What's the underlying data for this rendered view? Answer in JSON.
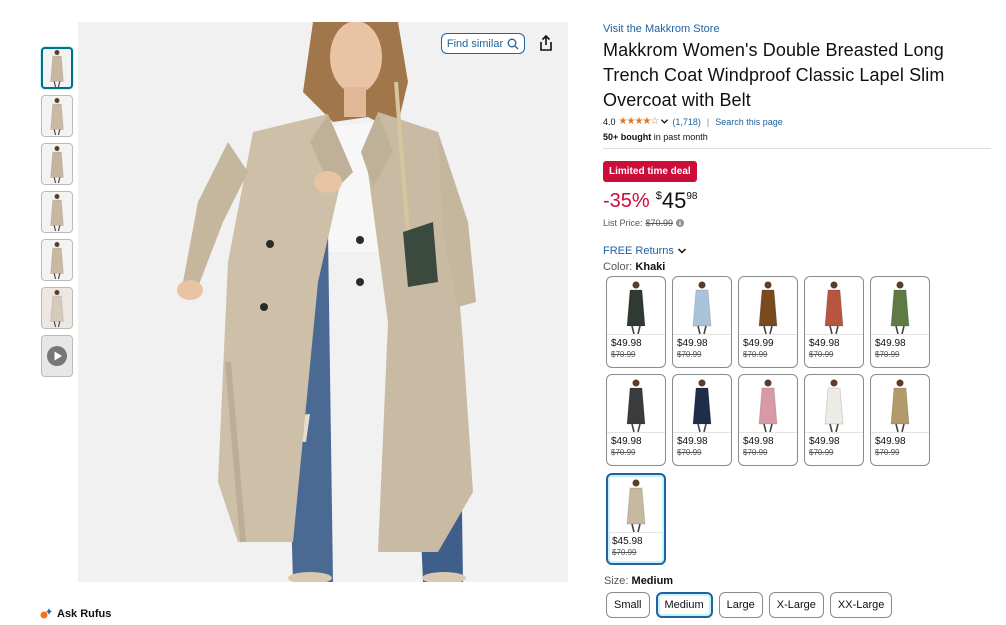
{
  "store": {
    "link": "Visit the Makkrom Store"
  },
  "product": {
    "title": "Makkrom Women's Double Breasted Long Trench Coat Windproof Classic Lapel Slim Overcoat with Belt",
    "rating": "4.0",
    "stars": "★★★★☆",
    "rating_count": "(1,718)",
    "search_page": "Search this page",
    "bought_bold": "50+ bought",
    "bought_rest": " in past month"
  },
  "deal": {
    "badge": "Limited time deal",
    "discount": "-35%",
    "price_symbol": "$",
    "price_whole": "45",
    "price_fraction": "98",
    "list_price_label": "List Price:",
    "list_price": "$70.99"
  },
  "returns": {
    "label": "FREE Returns"
  },
  "color": {
    "label": "Color:",
    "selected": "Khaki"
  },
  "toolbar": {
    "find_similar": "Find similar"
  },
  "rufus": {
    "label": "Ask Rufus"
  },
  "thumbnails": [
    {
      "color": "#c8b8a2",
      "kind": "photo"
    },
    {
      "color": "#cbb9a3",
      "kind": "photo"
    },
    {
      "color": "#c5b59f",
      "kind": "photo"
    },
    {
      "color": "#c9b8a1",
      "kind": "photo"
    },
    {
      "color": "#cab8a0",
      "kind": "photo"
    },
    {
      "color": "#d4cbbd",
      "kind": "grid"
    },
    {
      "color": "#777777",
      "kind": "video"
    }
  ],
  "swatches": [
    {
      "coat": "#2f3a33",
      "price": "$49.98",
      "list": "$70.99"
    },
    {
      "coat": "#a9c4da",
      "price": "$49.98",
      "list": "$70.99"
    },
    {
      "coat": "#7a4a1f",
      "price": "$49.99",
      "list": "$70.99"
    },
    {
      "coat": "#b8553f",
      "price": "$49.98",
      "list": "$70.99"
    },
    {
      "coat": "#5f7a45",
      "price": "$49.98",
      "list": "$70.99"
    },
    {
      "coat": "#3b3b3b",
      "price": "$49.98",
      "list": "$70.99"
    },
    {
      "coat": "#1f2d4a",
      "price": "$49.98",
      "list": "$70.99"
    },
    {
      "coat": "#d99aa8",
      "price": "$49.98",
      "list": "$70.99"
    },
    {
      "coat": "#ecebe6",
      "price": "$49.98",
      "list": "$70.99"
    },
    {
      "coat": "#b39a6a",
      "price": "$49.98",
      "list": "$70.99"
    },
    {
      "coat": "#c7b9a0",
      "price": "$45.98",
      "list": "$70.99",
      "selected": true
    }
  ],
  "size": {
    "label": "Size:",
    "selected": "Medium",
    "options": [
      "Small",
      "Medium",
      "Large",
      "X-Large",
      "XX-Large"
    ]
  },
  "colors": {
    "link": "#2162a1",
    "deal": "#cc0c39",
    "star": "#de7921",
    "coat_main": "#cdbfa8",
    "jeans": "#4a6a94"
  }
}
